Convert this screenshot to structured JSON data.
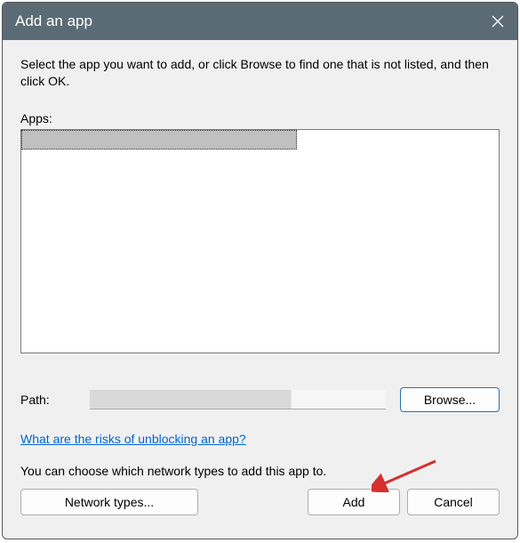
{
  "titlebar": {
    "title": "Add an app"
  },
  "instructions": "Select the app you want to add, or click Browse to find one that is not listed, and then click OK.",
  "apps": {
    "label": "Apps:",
    "items": [
      {
        "name": ""
      }
    ]
  },
  "path": {
    "label": "Path:",
    "value": "",
    "browse": "Browse..."
  },
  "risks_link": "What are the risks of unblocking an app?",
  "network_text": "You can choose which network types to add this app to.",
  "buttons": {
    "network_types": "Network types...",
    "add": "Add",
    "cancel": "Cancel"
  }
}
